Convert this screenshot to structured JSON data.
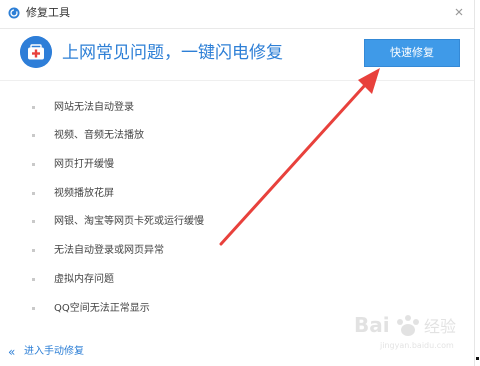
{
  "window": {
    "title": "修复工具",
    "app_icon": "app-logo-icon",
    "close_icon": "close-icon"
  },
  "header": {
    "icon": "medical-kit-icon",
    "headline": "上网常见问题，一键闪电修复",
    "fix_button_label": "快速修复"
  },
  "issues": [
    "网站无法自动登录",
    "视频、音频无法播放",
    "网页打开缓慢",
    "视频播放花屏",
    "网银、淘宝等网页卡死或运行缓慢",
    "无法自动登录或网页异常",
    "虚拟内存问题",
    "QQ空间无法正常显示"
  ],
  "footer": {
    "manual_link_label": "进入手动修复",
    "chevron_icon": "double-chevron-left-icon"
  },
  "watermark_text": "Baidu经验",
  "colors": {
    "accent": "#2d7fd6",
    "button": "#3f9ae8",
    "arrow": "#e8413c"
  }
}
